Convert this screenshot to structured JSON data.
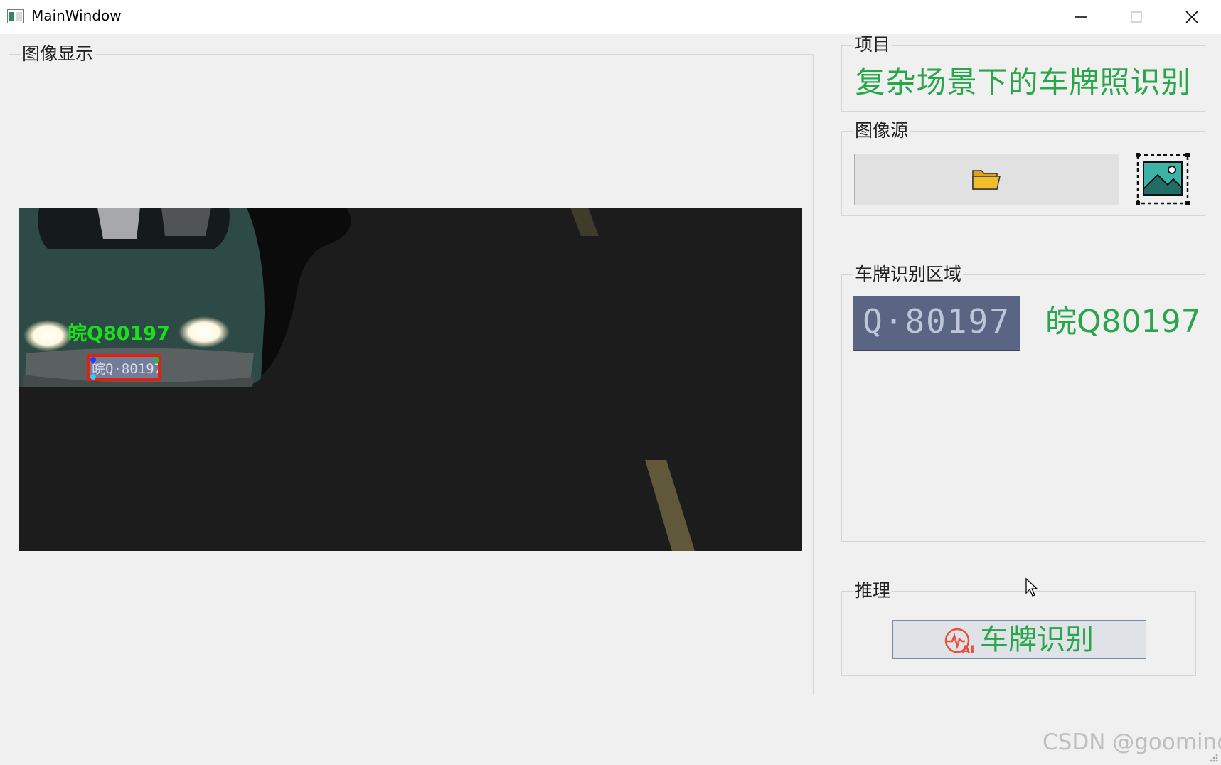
{
  "window": {
    "title": "MainWindow",
    "icons": [
      "minimize-icon",
      "maximize-icon",
      "close-icon"
    ]
  },
  "display_panel": {
    "title": "图像显示",
    "overlay_label": "皖Q80197",
    "plate_text": "皖Q·80197"
  },
  "project_panel": {
    "title": "项目",
    "name": "复杂场景下的车牌照识别"
  },
  "source_panel": {
    "title": "图像源",
    "open_button_icon": "folder-icon",
    "image_button_icon": "image-icon"
  },
  "plate_panel": {
    "title": "车牌识别区域",
    "crop_text": "Q·80197",
    "result": "皖Q80197"
  },
  "inference_panel": {
    "title": "推理",
    "button_label": "车牌识别",
    "button_icon": "ai-icon"
  },
  "watermark": "CSDN @goomind",
  "colors": {
    "accent_green": "#2aa64a",
    "detect_box": "#e02010",
    "overlay_green": "#19e01a"
  }
}
